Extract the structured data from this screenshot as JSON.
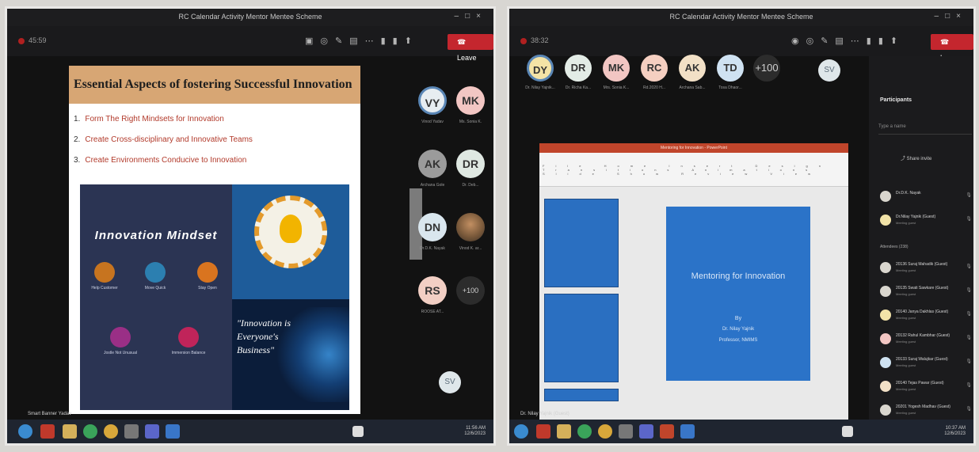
{
  "left": {
    "window_title": "RC Calendar Activity Mentor Mentee Scheme",
    "toolbar_time": "45:59",
    "leave_label": "Leave",
    "slide": {
      "title": "Essential Aspects of fostering Successful Innovation",
      "points": [
        {
          "num": "1.",
          "text": "Form The Right Mindsets for Innovation"
        },
        {
          "num": "2.",
          "text": "Create Cross-disciplinary and Innovative Teams"
        },
        {
          "num": "3.",
          "text": "Create Environments Conducive to Innovation"
        }
      ],
      "mindset_title": "Innovation Mindset",
      "mindset_items": [
        "Help Customer",
        "Move Quick",
        "Stay Open",
        "Jostle Not Unusual",
        "Immersion Balance"
      ],
      "quote": "\"Innovation is Everyone's Business\""
    },
    "participants": [
      {
        "initials": "VY",
        "name": "Vinod Yadav",
        "color": "#e7edf1",
        "ring": "#5a86b5"
      },
      {
        "initials": "MK",
        "name": "Ms. Sonia K.",
        "color": "#f2c6c3",
        "ring": ""
      },
      {
        "initials": "AK",
        "name": "Archana Gole",
        "color": "#9b9b9b",
        "ring": ""
      },
      {
        "initials": "DR",
        "name": "Dr. Deb...",
        "color": "#dfe8e2",
        "ring": ""
      },
      {
        "initials": "DN",
        "name": "Dr.D.K. Nayak",
        "color": "#d9e6ee",
        "ring": ""
      },
      {
        "initials": "",
        "name": "Vinod K. ar...",
        "color": "",
        "ring": "",
        "photo": true
      },
      {
        "initials": "RS",
        "name": "ROOSE AT...",
        "color": "#f2cfc4",
        "ring": ""
      },
      {
        "initials": "+100",
        "name": "",
        "color": "",
        "ring": "",
        "overflow": true
      }
    ],
    "self_initials": "SV",
    "screen_share_name": "Smart Banner Yadav",
    "clock_time": "11:56 AM",
    "clock_date": "12/6/2023"
  },
  "right": {
    "window_title": "RC Calendar Activity Mentor Mentee Scheme",
    "toolbar_time": "38:32",
    "leave_label": "Leave",
    "top_participants": [
      {
        "initials": "DY",
        "name": "Dr. Nilay Yajnik...",
        "color": "#f4e3a6",
        "ring": "#5a86b5"
      },
      {
        "initials": "DR",
        "name": "Dr. Richa Ka...",
        "color": "#e3ece6"
      },
      {
        "initials": "MK",
        "name": "Mrs. Sonia K...",
        "color": "#f2c6c3"
      },
      {
        "initials": "RC",
        "name": "Rd.2020 H...",
        "color": "#f5cfc1"
      },
      {
        "initials": "AK",
        "name": "Archana Sab...",
        "color": "#f2e0c6"
      },
      {
        "initials": "TD",
        "name": "Tosa Dhaor...",
        "color": "#cfe2f2"
      },
      {
        "initials": "+100",
        "name": "",
        "color": "",
        "overflow": true
      }
    ],
    "self_initials": "SV",
    "ppt": {
      "window_title": "Mentoring for Innovation - PowerPoint",
      "tabs": [
        "File",
        "Home",
        "Insert",
        "Design",
        "Transitions",
        "Animations",
        "Slide Show",
        "Review",
        "View"
      ],
      "slide_title": "Mentoring for Innovation",
      "slide_sub1": "By",
      "slide_sub2": "Dr. Nilay Yajnik",
      "slide_sub3": "Professor, NMIMS"
    },
    "people_panel": {
      "title": "Participants",
      "search_placeholder": "Type a name",
      "share_invite": "Share invite",
      "presenters": [
        {
          "name": "Dr.D.K. Nayak",
          "role": ""
        },
        {
          "name": "Dr.Nilay Yajnik (Guest)",
          "role": "Meeting guest"
        }
      ],
      "attendees_label": "Attendees (238)",
      "attendees": [
        {
          "name": "20136 Suraj Mahadik (Guest)",
          "role": "Meeting guest"
        },
        {
          "name": "20135 Swati Sawkare (Guest)",
          "role": "Meeting guest"
        },
        {
          "name": "20140 Janya Dakhlas (Guest)",
          "role": "Meeting guest"
        },
        {
          "name": "20132 Rahul Kambhar (Guest)",
          "role": "Meeting guest"
        },
        {
          "name": "20133 Suraj Walujkar (Guest)",
          "role": "Meeting guest"
        },
        {
          "name": "20140 Tejas Pawar (Guest)",
          "role": "Meeting guest"
        },
        {
          "name": "20201 Yogesh Madhav (Guest)",
          "role": "Meeting guest"
        }
      ]
    },
    "presenter_tag": "Dr. Nilay Yajnik (Guest)",
    "clock_time": "10:37 AM",
    "clock_date": "12/6/2023"
  }
}
